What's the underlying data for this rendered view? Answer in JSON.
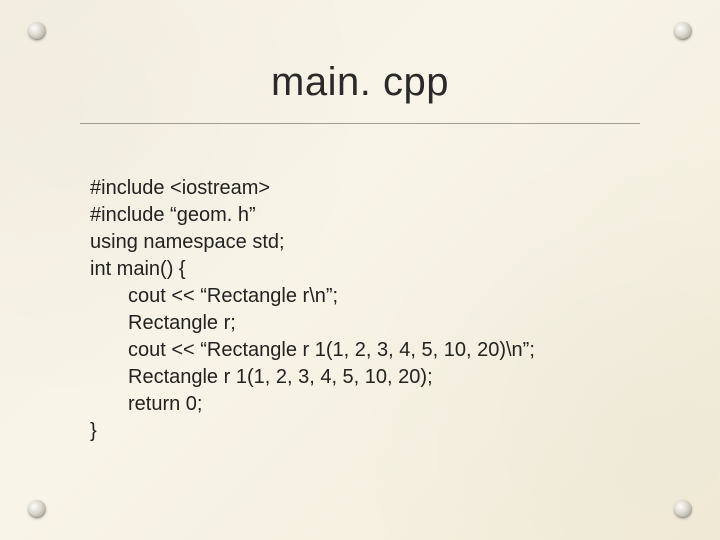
{
  "slide": {
    "title": "main. cpp",
    "code": {
      "l1": "#include <iostream>",
      "l2": "#include “geom. h”",
      "l3": "using namespace std;",
      "l4": "int main() {",
      "l5": "cout << “Rectangle r\\n”;",
      "l6": "Rectangle r;",
      "l7": "cout << “Rectangle r 1(1, 2, 3, 4, 5, 10, 20)\\n”;",
      "l8": "Rectangle r 1(1, 2, 3, 4, 5, 10, 20);",
      "l9": "return 0;",
      "l10": "}"
    }
  }
}
